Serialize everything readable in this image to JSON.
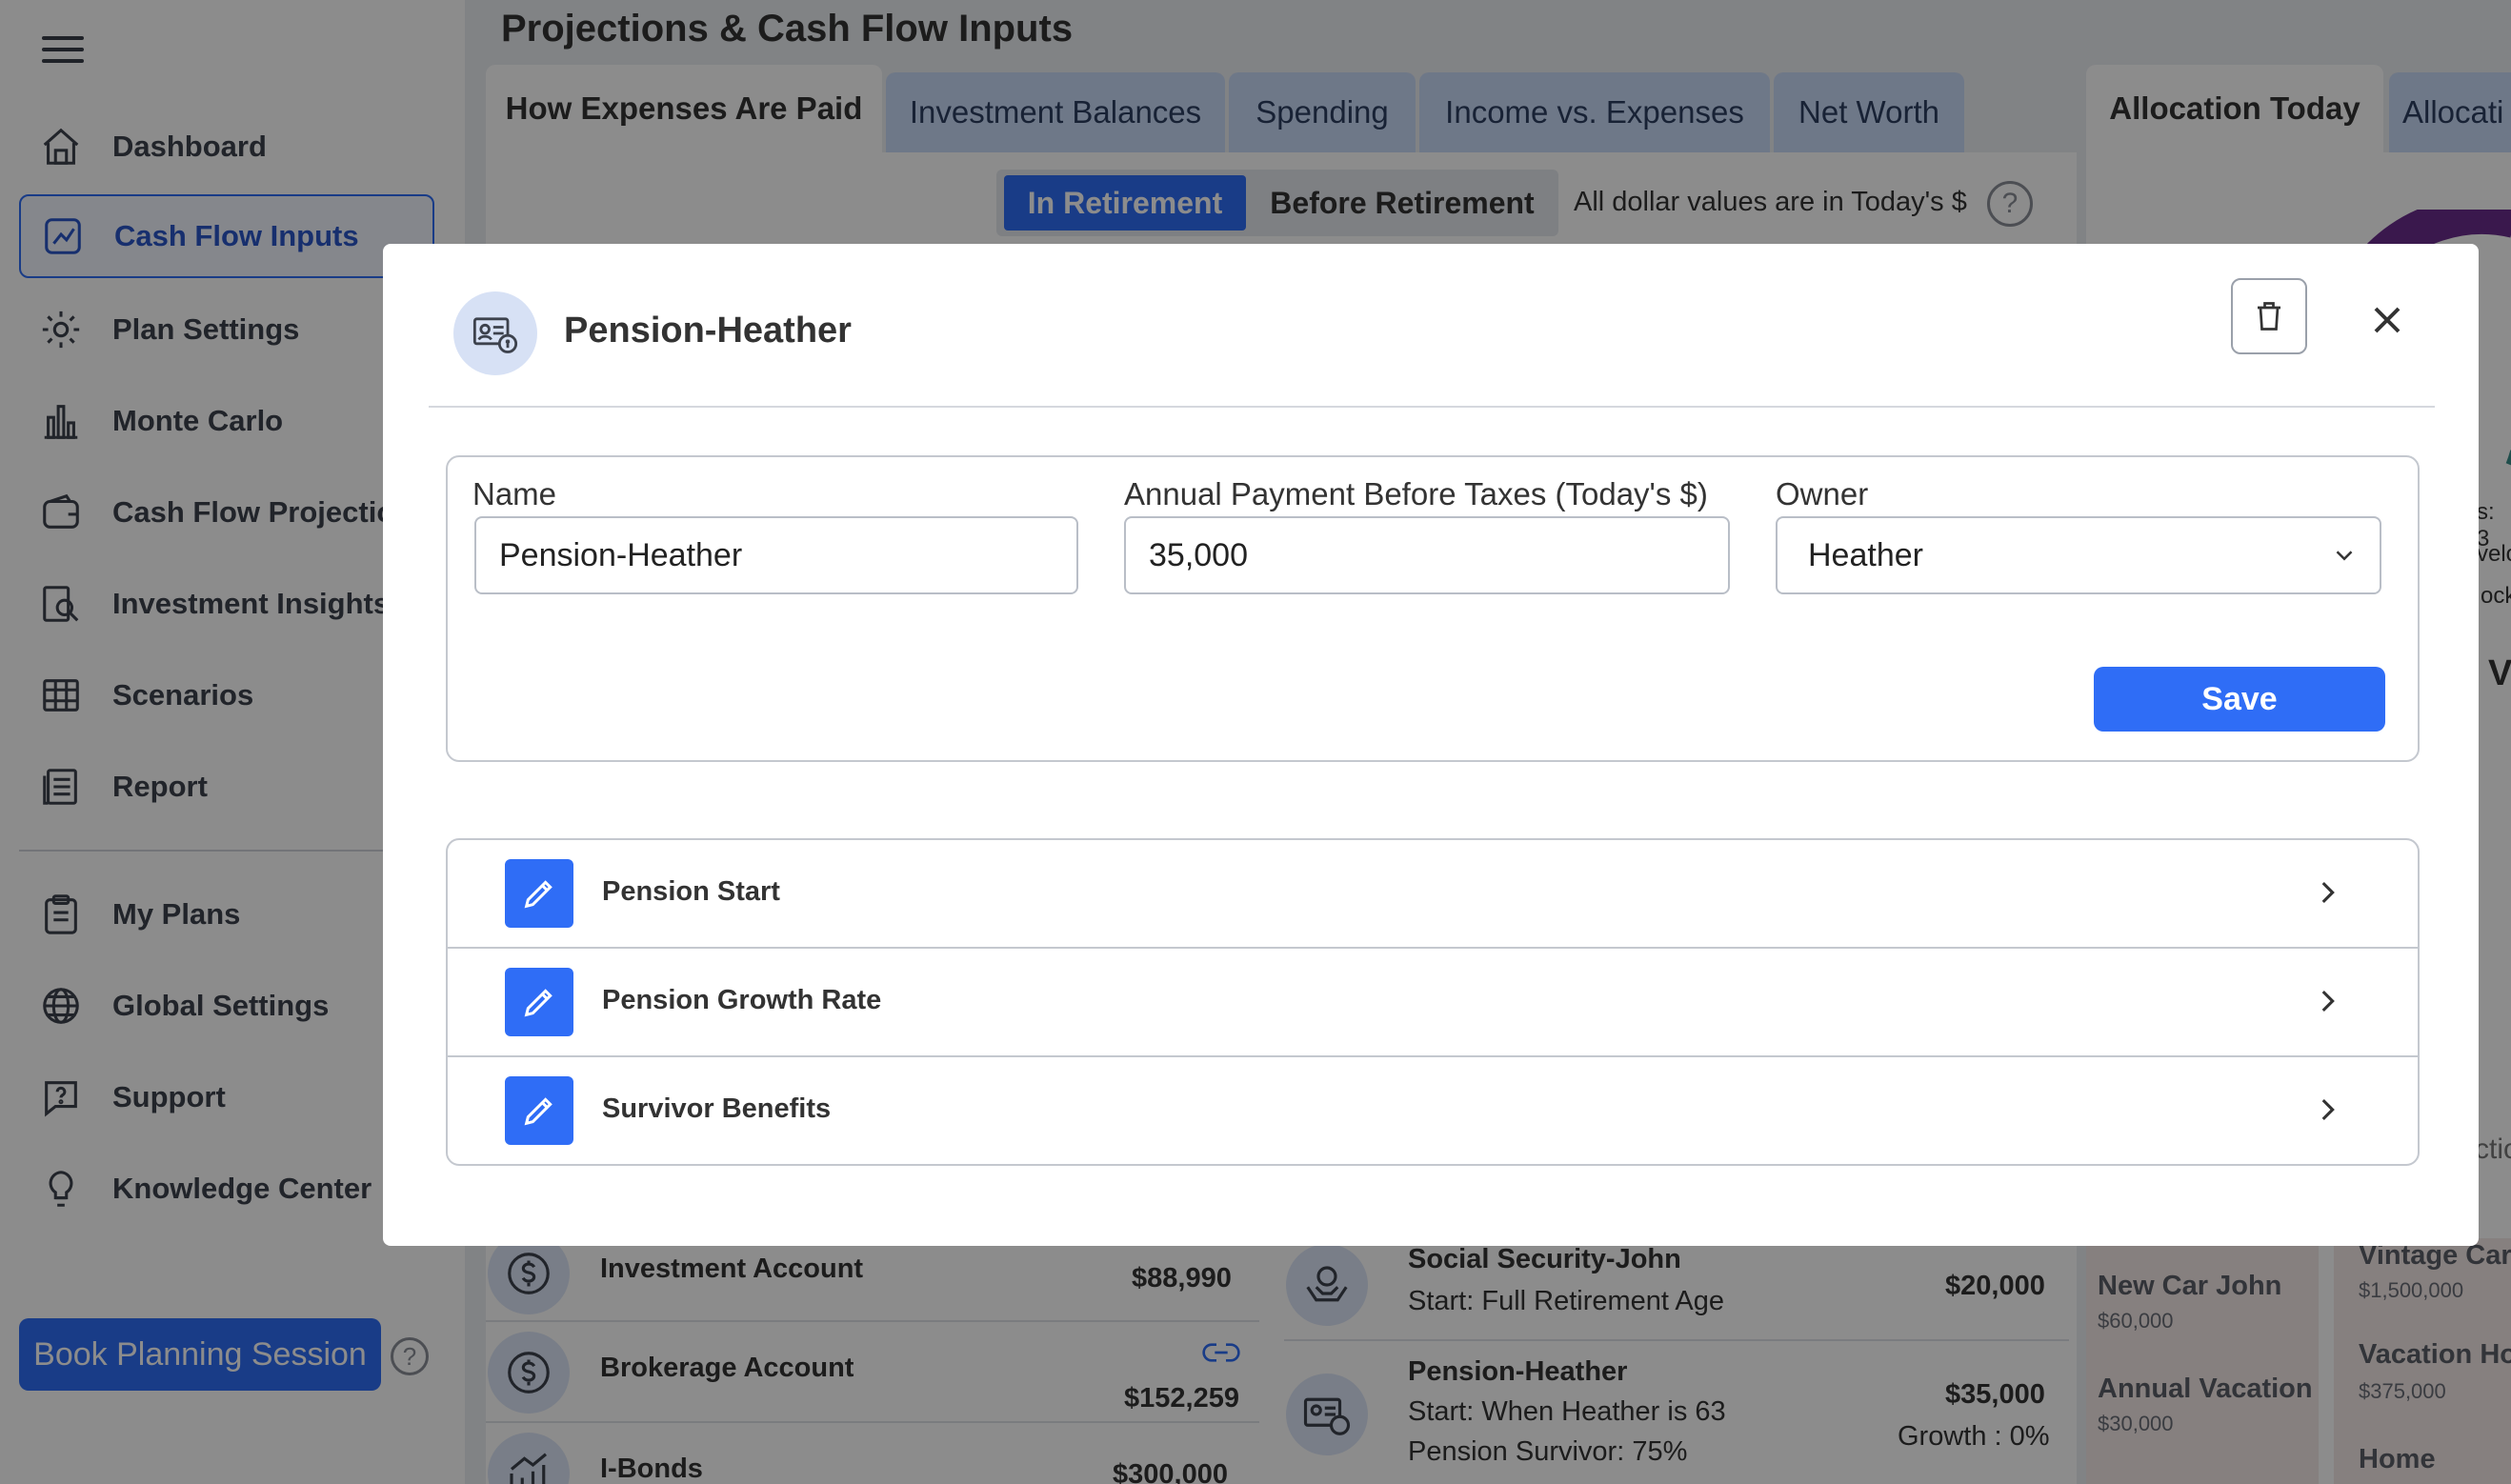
{
  "sidebar": {
    "items": [
      {
        "label": "Dashboard",
        "icon": "house-icon"
      },
      {
        "label": "Cash Flow Inputs",
        "icon": "chart-icon"
      },
      {
        "label": "Plan Settings",
        "icon": "gear-icon"
      },
      {
        "label": "Monte Carlo",
        "icon": "bar-chart-icon"
      },
      {
        "label": "Cash Flow Projections",
        "icon": "wallet-icon"
      },
      {
        "label": "Investment Insights",
        "icon": "magnifier-icon"
      },
      {
        "label": "Scenarios",
        "icon": "grid-icon"
      },
      {
        "label": "Report",
        "icon": "document-icon"
      },
      {
        "label": "My Plans",
        "icon": "clipboard-icon"
      },
      {
        "label": "Global Settings",
        "icon": "globe-icon"
      },
      {
        "label": "Support",
        "icon": "chat-help-icon"
      },
      {
        "label": "Knowledge Center",
        "icon": "lightbulb-icon"
      }
    ],
    "active_index": 1,
    "book_button": "Book Planning Session",
    "help_glyph": "?"
  },
  "main": {
    "title": "Projections & Cash Flow Inputs",
    "tabs": [
      "How Expenses Are Paid",
      "Investment Balances",
      "Spending",
      "Income vs. Expenses",
      "Net Worth"
    ],
    "active_tab": 0,
    "right_tabs": [
      "Allocation Today",
      "Allocati"
    ],
    "segment": {
      "active": "In Retirement",
      "inactive": "Before Retirement"
    },
    "dollar_note": "All dollar values are in Today's $",
    "accounts": [
      {
        "name": "Investment Account",
        "amount": "$88,990"
      },
      {
        "name": "Brokerage Account",
        "amount": "$152,259"
      },
      {
        "name": "I-Bonds",
        "amount": "$300,000"
      }
    ],
    "income": [
      {
        "name": "Social Security-John",
        "line2": "Start: Full Retirement Age",
        "amount": "$20,000"
      },
      {
        "name": "Pension-Heather",
        "line2": "Start: When Heather is 63",
        "line3": "Pension Survivor: 75%",
        "amount": "$35,000",
        "growth": "Growth : 0%"
      }
    ],
    "goals": [
      {
        "name": "New Car John",
        "amount": "$60,000"
      },
      {
        "name": "Annual Vacation",
        "amount": "$30,000"
      }
    ],
    "goals2": [
      {
        "name": "Vintage Car",
        "amount": "$1,500,000"
      },
      {
        "name": "Vacation Ho",
        "amount": "$375,000"
      },
      {
        "name": "Home",
        "amount": ""
      }
    ],
    "right_fragments": [
      "s: 3",
      "velo",
      "ock",
      "V",
      "ctio"
    ]
  },
  "modal": {
    "title": "Pension-Heather",
    "fields": {
      "name_label": "Name",
      "name_value": "Pension-Heather",
      "payment_label": "Annual Payment Before Taxes (Today's $)",
      "payment_value": "35,000",
      "owner_label": "Owner",
      "owner_value": "Heather"
    },
    "save_label": "Save",
    "sections": [
      "Pension Start",
      "Pension Growth Rate",
      "Survivor Benefits"
    ]
  },
  "colors": {
    "accent": "#2f6df6",
    "tab_bg": "#c9daf7"
  }
}
